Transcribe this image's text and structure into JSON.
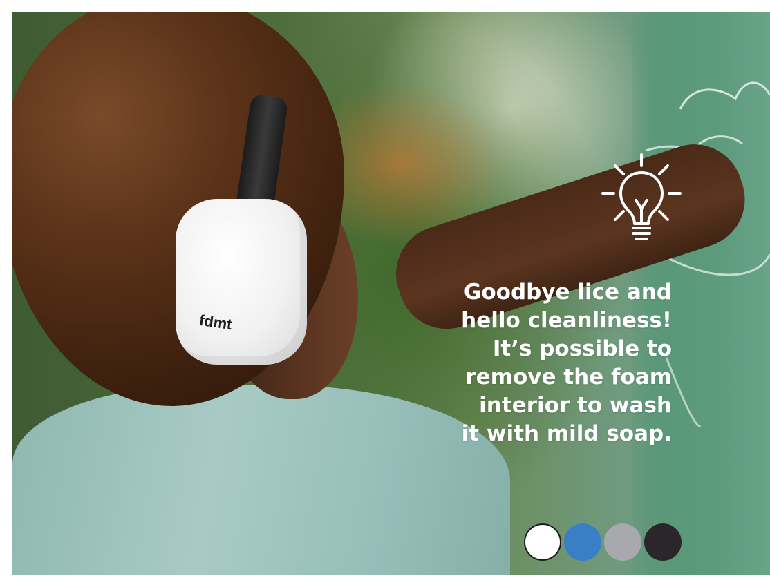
{
  "hero": {
    "brand_text": "fdmt",
    "headline_lines": [
      "Goodbye lice and",
      "hello cleanliness!",
      "It’s possible to",
      "remove the foam",
      "interior to wash",
      "it with mild soap."
    ],
    "icon": "lightbulb-icon"
  },
  "color_options": [
    {
      "name": "white",
      "hex": "#ffffff",
      "border": "#1a1a1a"
    },
    {
      "name": "blue",
      "hex": "#3a7fc6",
      "border": "#3a7fc6"
    },
    {
      "name": "gray",
      "hex": "#a8a9ac",
      "border": "#a8a9ac"
    },
    {
      "name": "black",
      "hex": "#2a2629",
      "border": "#2a2629"
    }
  ]
}
